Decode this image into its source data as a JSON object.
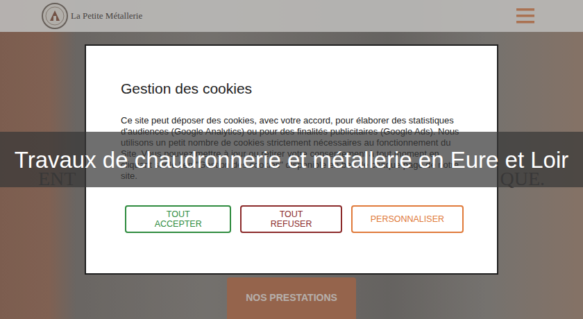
{
  "header": {
    "logo_text": "La Petite Métallerie"
  },
  "hero": {
    "heading_left": "ENT",
    "heading_right": "QUE.",
    "button": "NOS PRESTATIONS"
  },
  "cookie_dialog": {
    "title": "Gestion des cookies",
    "text": "Ce site peut déposer des cookies, avec votre accord, pour élaborer des statistiques d'audiences (Google Analytics) ou pour des finalités publicitaires (Google Ads). Nous utilisons un petit nombre de cookies strictement nécessaires au fonctionnement du Site. Vous pouvez mettre à jour ou retirer votre consentement à tout moment en cliquant sur le lien \"Gestion des cookies\" disponible en bas de chaque page de notre site.",
    "buttons": [
      {
        "label": "TOUT ACCEPTER",
        "color": "#2e8b3e"
      },
      {
        "label": "TOUT REFUSER",
        "color": "#8b2a2a"
      },
      {
        "label": "PERSONNALISER",
        "color": "#e07a3a"
      }
    ]
  },
  "caption": "Travaux de chaudronnerie et métallerie en Eure et Loir"
}
